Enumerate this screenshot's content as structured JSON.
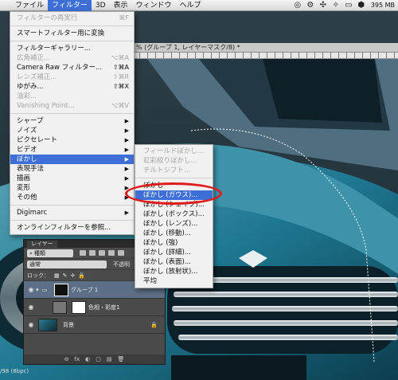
{
  "menubar": {
    "apple": "",
    "items": [
      {
        "label": "ファイル"
      },
      {
        "label": "フィルター"
      },
      {
        "label": "3D"
      },
      {
        "label": "表示"
      },
      {
        "label": "ウィンドウ"
      },
      {
        "label": "ヘルプ"
      }
    ],
    "battery": "395 MB"
  },
  "document": {
    "tab_title": "% (グループ 1, レイヤーマスク/8) *",
    "status": "/98 (8bpc)"
  },
  "filter_menu": {
    "items": [
      {
        "label": "フィルターの再実行",
        "shortcut": "⌘F",
        "disabled": true
      },
      {
        "sep": true
      },
      {
        "label": "スマートフィルター用に変換"
      },
      {
        "sep": true
      },
      {
        "label": "フィルターギャラリー..."
      },
      {
        "label": "広角補正...",
        "shortcut": "⌥⌘A",
        "disabled": true
      },
      {
        "label": "Camera Raw フィルター...",
        "shortcut": "⇧⌘A"
      },
      {
        "label": "レンズ補正...",
        "shortcut": "⇧⌘R",
        "disabled": true
      },
      {
        "label": "ゆがみ...",
        "shortcut": "⇧⌘X"
      },
      {
        "label": "油彩...",
        "disabled": true
      },
      {
        "label": "Vanishing Point...",
        "shortcut": "⌥⌘V",
        "disabled": true
      },
      {
        "sep": true
      },
      {
        "label": "シャープ",
        "submenu": true
      },
      {
        "label": "ノイズ",
        "submenu": true
      },
      {
        "label": "ピクセレート",
        "submenu": true
      },
      {
        "label": "ビデオ",
        "submenu": true
      },
      {
        "label": "ぼかし",
        "submenu": true,
        "highlight": true
      },
      {
        "label": "表現手法",
        "submenu": true
      },
      {
        "label": "描画",
        "submenu": true
      },
      {
        "label": "変形",
        "submenu": true
      },
      {
        "label": "その他",
        "submenu": true
      },
      {
        "sep": true
      },
      {
        "label": "Digimarc",
        "submenu": true
      },
      {
        "sep": true
      },
      {
        "label": "オンラインフィルターを参照..."
      }
    ]
  },
  "blur_submenu": {
    "items": [
      {
        "label": "フィールドぼかし...",
        "disabled": true
      },
      {
        "label": "虹彩絞りぼかし...",
        "disabled": true
      },
      {
        "label": "チルトシフト...",
        "disabled": true
      },
      {
        "sep": true
      },
      {
        "label": "ぼかし"
      },
      {
        "label": "ぼかし (ガウス)...",
        "highlight": true
      },
      {
        "label": "ぼかし (シェイプ)..."
      },
      {
        "label": "ぼかし (ボックス)..."
      },
      {
        "label": "ぼかし (レンズ)..."
      },
      {
        "label": "ぼかし (移動)..."
      },
      {
        "label": "ぼかし (強)"
      },
      {
        "label": "ぼかし (詳細)..."
      },
      {
        "label": "ぼかし (表面)..."
      },
      {
        "label": "ぼかし (放射状)..."
      },
      {
        "label": "平均"
      }
    ]
  },
  "layers_panel": {
    "tab": "レイヤー",
    "kind_filter": "種類",
    "blend_mode": "通常",
    "opacity_label": "不透明",
    "lock_label": "ロック：",
    "fill_label": "塗り",
    "layers": [
      {
        "name": "グループ 1",
        "type": "group"
      },
      {
        "name": "色相・彩度1",
        "type": "adjustment"
      },
      {
        "name": "背景",
        "type": "background"
      }
    ],
    "footer": [
      "⊖",
      "fx",
      "◐",
      "▢",
      "▤",
      "🗑"
    ]
  },
  "colors": {
    "menu_highlight": "#3d6fd7",
    "annotation_ring": "#e01b1b"
  }
}
